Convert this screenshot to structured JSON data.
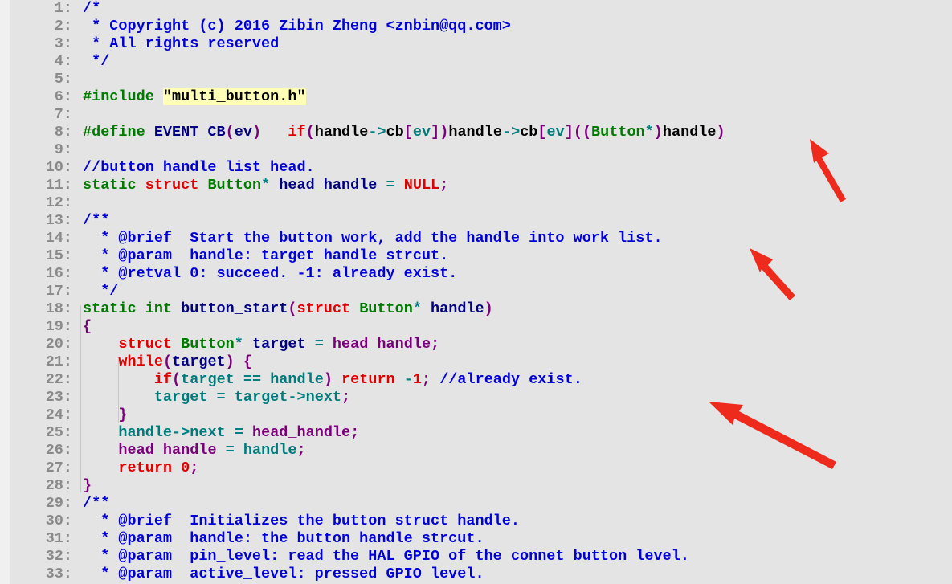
{
  "editor": {
    "lines": [
      {
        "n": "1:",
        "segs": [
          [
            "k-com",
            "/*"
          ]
        ]
      },
      {
        "n": "2:",
        "segs": [
          [
            "k-com",
            " * Copyright (c) 2016 Zibin Zheng <znbin@qq.com>"
          ]
        ]
      },
      {
        "n": "3:",
        "segs": [
          [
            "k-com",
            " * All rights reserved"
          ]
        ]
      },
      {
        "n": "4:",
        "segs": [
          [
            "k-com",
            " */"
          ]
        ]
      },
      {
        "n": "5:",
        "segs": []
      },
      {
        "n": "6:",
        "segs": [
          [
            "k-pre",
            "#include "
          ],
          [
            "k-str",
            "\"multi_button.h\""
          ]
        ]
      },
      {
        "n": "7:",
        "segs": []
      },
      {
        "n": "8:",
        "segs": [
          [
            "k-pre",
            "#define "
          ],
          [
            "k-plain",
            "EVENT_CB"
          ],
          [
            "k-punc",
            "("
          ],
          [
            "k-plain",
            "ev"
          ],
          [
            "k-punc",
            ")"
          ],
          [
            "k-plain",
            "   "
          ],
          [
            "k-kw",
            "if"
          ],
          [
            "k-punc",
            "("
          ],
          [
            "k-black",
            "handle"
          ],
          [
            "k-op",
            "->"
          ],
          [
            "k-black",
            "cb"
          ],
          [
            "k-punc",
            "["
          ],
          [
            "k-mem",
            "ev"
          ],
          [
            "k-punc",
            "])"
          ],
          [
            "k-black",
            "handle"
          ],
          [
            "k-op",
            "->"
          ],
          [
            "k-black",
            "cb"
          ],
          [
            "k-punc",
            "["
          ],
          [
            "k-mem",
            "ev"
          ],
          [
            "k-punc",
            "](("
          ],
          [
            "k-typ",
            "Button"
          ],
          [
            "k-op",
            "*"
          ],
          [
            "k-punc",
            ")"
          ],
          [
            "k-black",
            "handle"
          ],
          [
            "k-punc",
            ")"
          ]
        ]
      },
      {
        "n": "9:",
        "segs": []
      },
      {
        "n": "10:",
        "segs": [
          [
            "k-com",
            "//button handle list head."
          ]
        ]
      },
      {
        "n": "11:",
        "segs": [
          [
            "k-typ",
            "static "
          ],
          [
            "k-kw",
            "struct "
          ],
          [
            "k-typ",
            "Button"
          ],
          [
            "k-op",
            "* "
          ],
          [
            "k-plain",
            "head_handle "
          ],
          [
            "k-op",
            "= "
          ],
          [
            "k-kw",
            "NULL"
          ],
          [
            "k-punc",
            ";"
          ]
        ]
      },
      {
        "n": "12:",
        "segs": []
      },
      {
        "n": "13:",
        "segs": [
          [
            "k-com",
            "/**"
          ]
        ]
      },
      {
        "n": "14:",
        "segs": [
          [
            "k-com",
            "  * @brief  Start the button work, add the handle into work list."
          ]
        ]
      },
      {
        "n": "15:",
        "segs": [
          [
            "k-com",
            "  * @param  handle: target handle strcut."
          ]
        ]
      },
      {
        "n": "16:",
        "segs": [
          [
            "k-com",
            "  * @retval 0: succeed. -1: already exist."
          ]
        ]
      },
      {
        "n": "17:",
        "segs": [
          [
            "k-com",
            "  */"
          ]
        ]
      },
      {
        "n": "18:",
        "segs": [
          [
            "k-typ",
            "static "
          ],
          [
            "k-typ",
            "int "
          ],
          [
            "k-plain",
            "button_start"
          ],
          [
            "k-punc",
            "("
          ],
          [
            "k-kw",
            "struct "
          ],
          [
            "k-typ",
            "Button"
          ],
          [
            "k-op",
            "* "
          ],
          [
            "k-plain",
            "handle"
          ],
          [
            "k-punc",
            ")"
          ]
        ]
      },
      {
        "n": "19:",
        "segs": [
          [
            "k-punc",
            "{"
          ]
        ]
      },
      {
        "n": "20:",
        "segs": [
          [
            "k-plain",
            "    "
          ],
          [
            "k-kw",
            "struct "
          ],
          [
            "k-typ",
            "Button"
          ],
          [
            "k-op",
            "* "
          ],
          [
            "k-plain",
            "target "
          ],
          [
            "k-op",
            "= "
          ],
          [
            "k-var",
            "head_handle"
          ],
          [
            "k-punc",
            ";"
          ]
        ]
      },
      {
        "n": "21:",
        "segs": [
          [
            "k-plain",
            "    "
          ],
          [
            "k-kw",
            "while"
          ],
          [
            "k-punc",
            "("
          ],
          [
            "k-plain",
            "target"
          ],
          [
            "k-punc",
            ") {"
          ]
        ]
      },
      {
        "n": "22:",
        "segs": [
          [
            "k-plain",
            "        "
          ],
          [
            "k-kw",
            "if"
          ],
          [
            "k-punc",
            "("
          ],
          [
            "k-mem",
            "target "
          ],
          [
            "k-op",
            "== "
          ],
          [
            "k-mem",
            "handle"
          ],
          [
            "k-punc",
            ") "
          ],
          [
            "k-kw",
            "return "
          ],
          [
            "k-op",
            "-"
          ],
          [
            "k-num",
            "1"
          ],
          [
            "k-punc",
            "; "
          ],
          [
            "k-com",
            "//already exist."
          ]
        ]
      },
      {
        "n": "23:",
        "segs": [
          [
            "k-plain",
            "        "
          ],
          [
            "k-mem",
            "target "
          ],
          [
            "k-op",
            "= "
          ],
          [
            "k-mem",
            "target"
          ],
          [
            "k-op",
            "->"
          ],
          [
            "k-mem",
            "next"
          ],
          [
            "k-punc",
            ";"
          ]
        ]
      },
      {
        "n": "24:",
        "segs": [
          [
            "k-plain",
            "    "
          ],
          [
            "k-punc",
            "}"
          ]
        ]
      },
      {
        "n": "25:",
        "segs": [
          [
            "k-plain",
            "    "
          ],
          [
            "k-mem",
            "handle"
          ],
          [
            "k-op",
            "->"
          ],
          [
            "k-mem",
            "next "
          ],
          [
            "k-op",
            "= "
          ],
          [
            "k-var",
            "head_handle"
          ],
          [
            "k-punc",
            ";"
          ]
        ]
      },
      {
        "n": "26:",
        "segs": [
          [
            "k-plain",
            "    "
          ],
          [
            "k-var",
            "head_handle "
          ],
          [
            "k-op",
            "= "
          ],
          [
            "k-mem",
            "handle"
          ],
          [
            "k-punc",
            ";"
          ]
        ]
      },
      {
        "n": "27:",
        "segs": [
          [
            "k-plain",
            "    "
          ],
          [
            "k-kw",
            "return "
          ],
          [
            "k-num",
            "0"
          ],
          [
            "k-punc",
            ";"
          ]
        ]
      },
      {
        "n": "28:",
        "segs": [
          [
            "k-punc",
            "}"
          ]
        ]
      },
      {
        "n": "29:",
        "segs": [
          [
            "k-com",
            "/**"
          ]
        ]
      },
      {
        "n": "30:",
        "segs": [
          [
            "k-com",
            "  * @brief  Initializes the button struct handle."
          ]
        ]
      },
      {
        "n": "31:",
        "segs": [
          [
            "k-com",
            "  * @param  handle: the button handle strcut."
          ]
        ]
      },
      {
        "n": "32:",
        "segs": [
          [
            "k-com",
            "  * @param  pin_level: read the HAL GPIO of the connet button level."
          ]
        ]
      },
      {
        "n": "33:",
        "segs": [
          [
            "k-com",
            "  * @param  active_level: pressed GPIO level."
          ]
        ]
      }
    ]
  },
  "annotations": {
    "arrow_color": "#ee2a1c",
    "arrow_icon": "red-arrow-icon"
  }
}
